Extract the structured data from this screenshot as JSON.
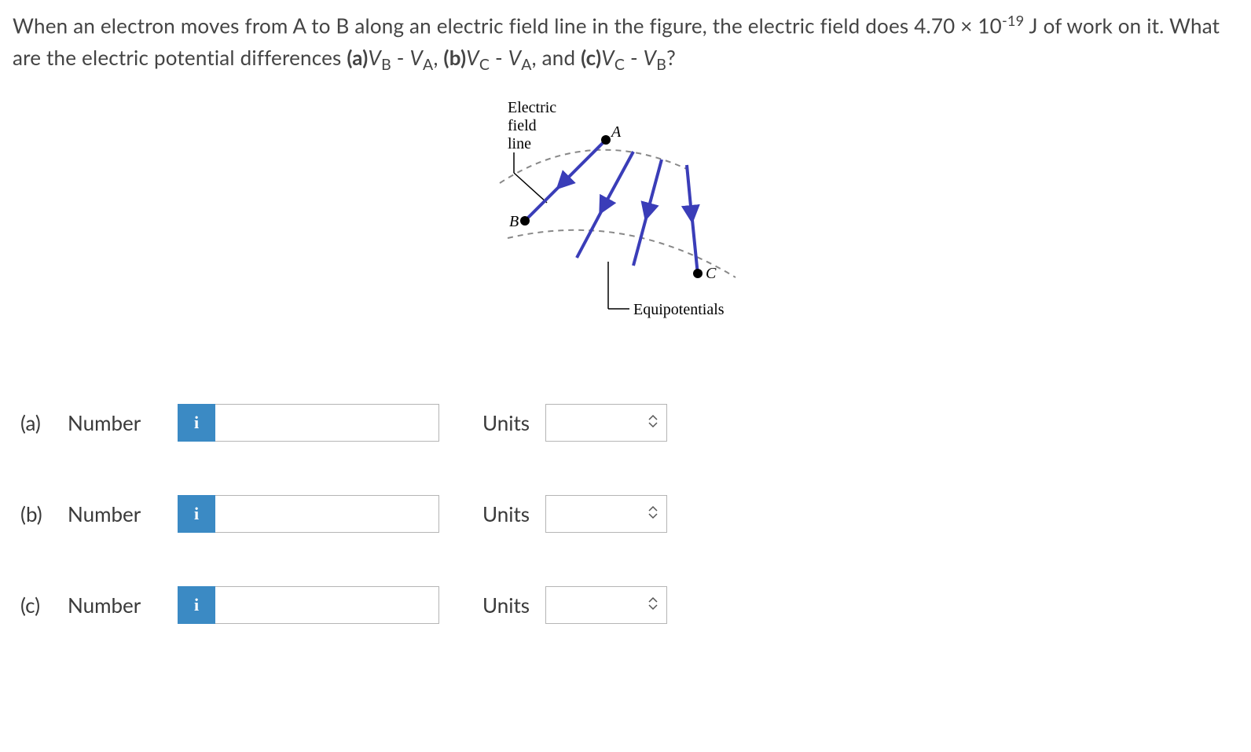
{
  "question": {
    "prefix": "When an electron moves from A to B along an electric field line in the figure, the electric field does 4.70 × 10",
    "exp": "-19",
    "mid": " J of work on it. What are the electric potential differences ",
    "pa_b": "(a)",
    "pa_v1": "V",
    "pa_s1": "B",
    "dash": " - ",
    "pa_v2": "V",
    "pa_s2": "A",
    "comma": ", ",
    "pb_b": "(b)",
    "pb_v1": "V",
    "pb_s1": "C",
    "pb_v2": "V",
    "pb_s2": "A",
    "and": ", and ",
    "pc_b": "(c)",
    "pc_v1": "V",
    "pc_s1": "C",
    "pc_v2": "V",
    "pc_s2": "B",
    "qmark": "?"
  },
  "figure": {
    "label_efl": "Electric",
    "label_efl2": "field",
    "label_efl3": "line",
    "label_A": "A",
    "label_B": "B",
    "label_C": "C",
    "label_equip": "Equipotentials"
  },
  "answers": {
    "a": {
      "part": "(a)",
      "number_label": "Number",
      "units_label": "Units",
      "value": "",
      "unit": ""
    },
    "b": {
      "part": "(b)",
      "number_label": "Number",
      "units_label": "Units",
      "value": "",
      "unit": ""
    },
    "c": {
      "part": "(c)",
      "number_label": "Number",
      "units_label": "Units",
      "value": "",
      "unit": ""
    }
  },
  "ui": {
    "info_glyph": "i",
    "chevron": "⇅"
  }
}
